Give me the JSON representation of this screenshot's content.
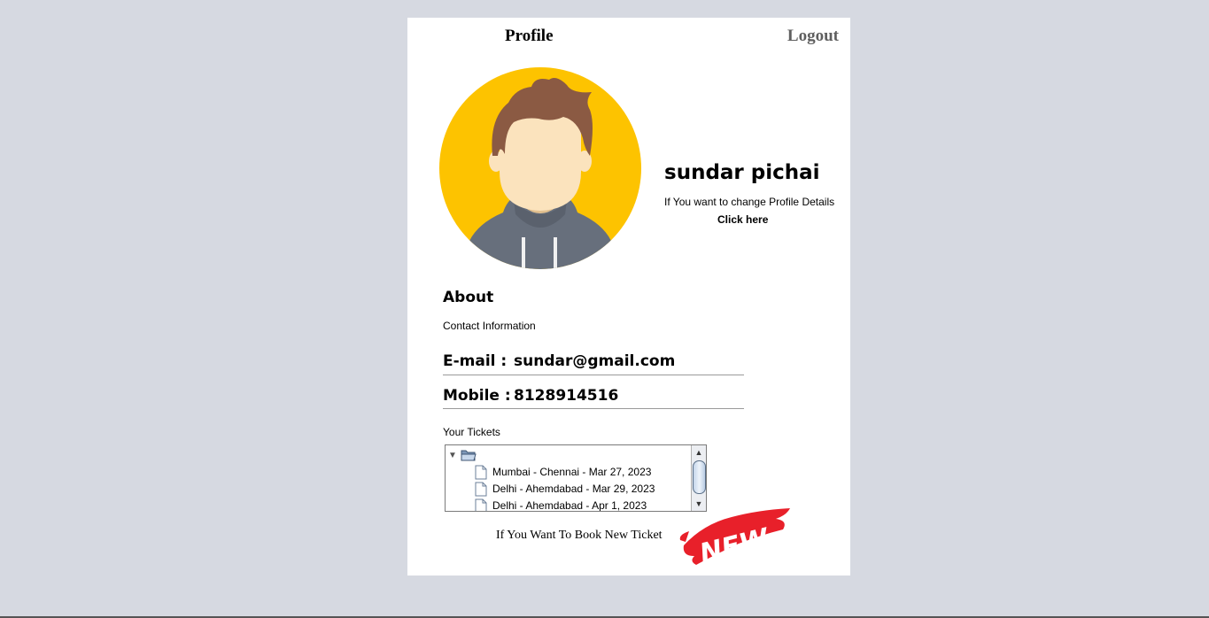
{
  "header": {
    "title": "Profile",
    "logout_label": "Logout"
  },
  "profile": {
    "name": "sundar pichai",
    "change_hint": "If You want to change Profile Details",
    "click_here": "Click here"
  },
  "about": {
    "heading": "About",
    "contact_heading": "Contact Information",
    "email_label": "E-mail :",
    "email_value": "sundar@gmail.com",
    "mobile_label": "Mobile :",
    "mobile_value": "8128914516"
  },
  "tickets": {
    "label": "Your Tickets",
    "items": [
      "Mumbai - Chennai - Mar 27, 2023",
      "Delhi - Ahemdabad - Mar 29, 2023",
      "Delhi - Ahemdabad - Apr 1, 2023"
    ]
  },
  "booking": {
    "text": "If You Want To Book New Ticket",
    "badge_text": "NEW"
  },
  "colors": {
    "background": "#d6d9e1",
    "avatar_circle": "#fdc300",
    "hair": "#8b5a43",
    "hoodie": "#676f7c",
    "badge_red": "#e8202a"
  }
}
